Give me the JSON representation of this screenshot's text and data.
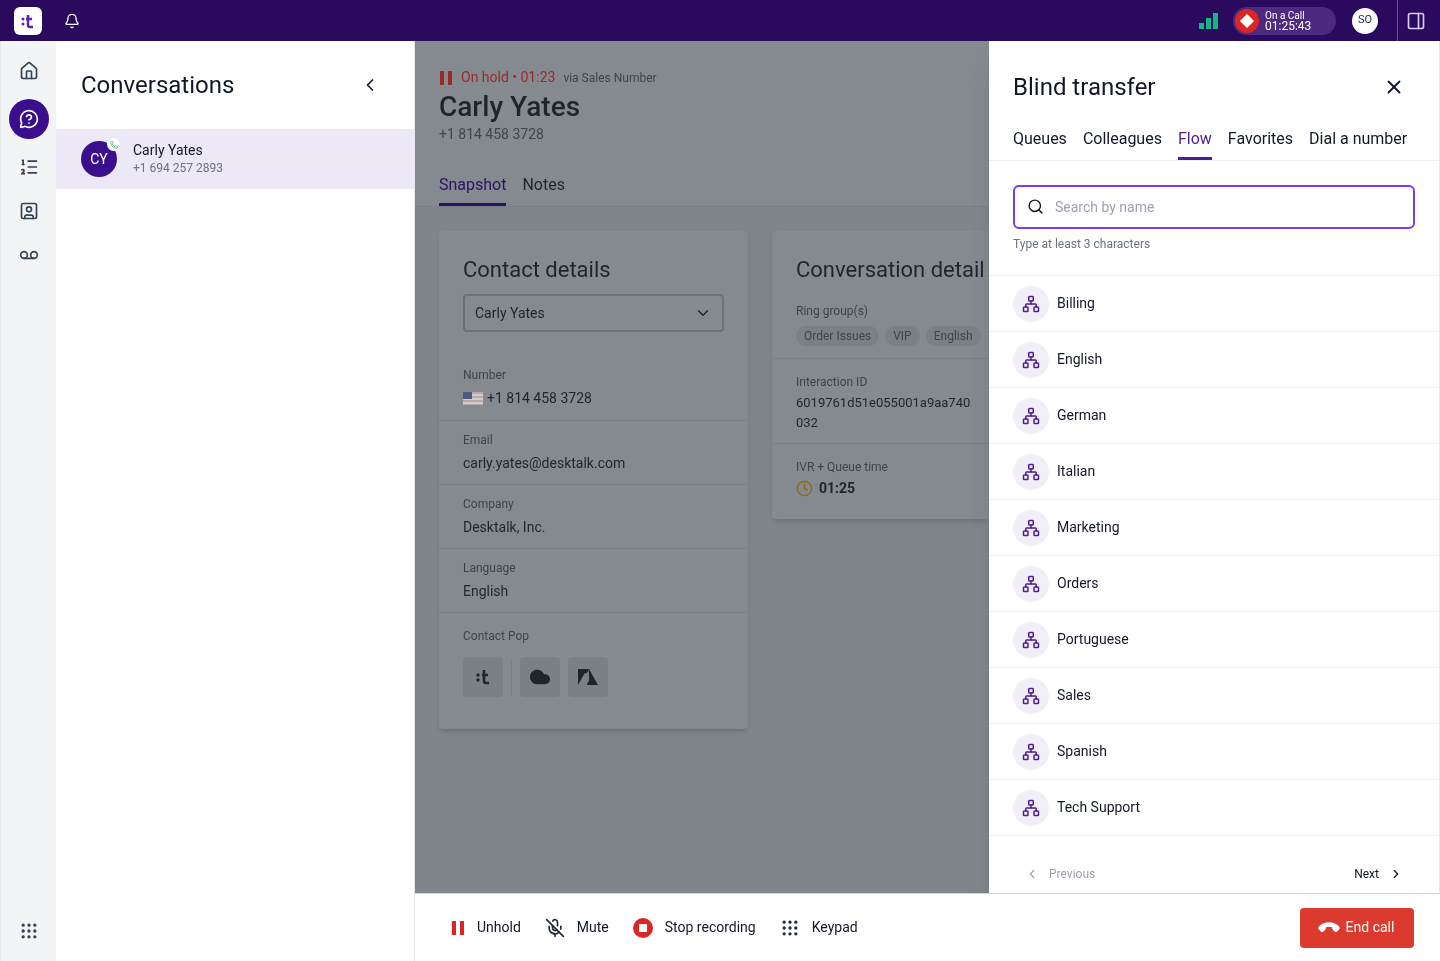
{
  "top_bar": {
    "call_status": {
      "label": "On a Call",
      "time": "01:25:43"
    },
    "avatar": "SO"
  },
  "rail": [
    {
      "selected": false
    },
    {
      "selected": true
    },
    {
      "selected": false
    },
    {
      "selected": false
    },
    {
      "selected": false
    }
  ],
  "conversations": {
    "title": "Conversations",
    "items": [
      {
        "initials": "CY",
        "name": "Carly Yates",
        "phone": "+1 694 257 2893",
        "selected": true
      }
    ]
  },
  "call": {
    "status": "On hold • 01:23",
    "via": "via Sales Number",
    "name": "Carly Yates",
    "phone": "+1 814 458 3728",
    "tabs": [
      {
        "label": "Snapshot",
        "selected": true
      },
      {
        "label": "Notes",
        "selected": false
      }
    ]
  },
  "contact_card": {
    "title": "Contact details",
    "select_value": "Carly Yates",
    "fields": [
      {
        "kind": "phone",
        "label": "Number",
        "value": "+1 814 458 3728"
      },
      {
        "kind": "text",
        "label": "Email",
        "value": "carly.yates@desktalk.com"
      },
      {
        "kind": "text",
        "label": "Company",
        "value": "Desktalk, Inc."
      },
      {
        "kind": "text",
        "label": "Language",
        "value": "English"
      }
    ],
    "contact_pop": "Contact Pop"
  },
  "conversation_card": {
    "title": "Conversation detail",
    "ring_label": "Ring group(s)",
    "tags": [
      "Order Issues",
      "VIP",
      "English"
    ],
    "id_label": "Interaction ID",
    "id_lines": [
      "6019761d51e055001a9aa740",
      "032"
    ],
    "queue_label": "IVR + Queue time",
    "queue_time": "01:25"
  },
  "transfer": {
    "title": "Blind transfer",
    "tabs": [
      {
        "label": "Queues",
        "selected": false
      },
      {
        "label": "Colleagues",
        "selected": false
      },
      {
        "label": "Flow",
        "selected": true
      },
      {
        "label": "Favorites",
        "selected": false
      },
      {
        "label": "Dial a number",
        "selected": false
      }
    ],
    "search": {
      "placeholder": "Search by name"
    },
    "hint": "Type at least 3 characters",
    "items": [
      "Billing",
      "English",
      "German",
      "Italian",
      "Marketing",
      "Orders",
      "Portuguese",
      "Sales",
      "Spanish",
      "Tech Support"
    ],
    "previous": {
      "label": "Previous",
      "disabled": true
    },
    "next": {
      "label": "Next",
      "disabled": false
    }
  },
  "controls": [
    {
      "kind": "hold",
      "label": "Unhold"
    },
    {
      "kind": "mute",
      "label": "Mute"
    },
    {
      "kind": "record",
      "label": "Stop recording"
    },
    {
      "kind": "keypad",
      "label": "Keypad"
    }
  ],
  "end_call": "End call"
}
